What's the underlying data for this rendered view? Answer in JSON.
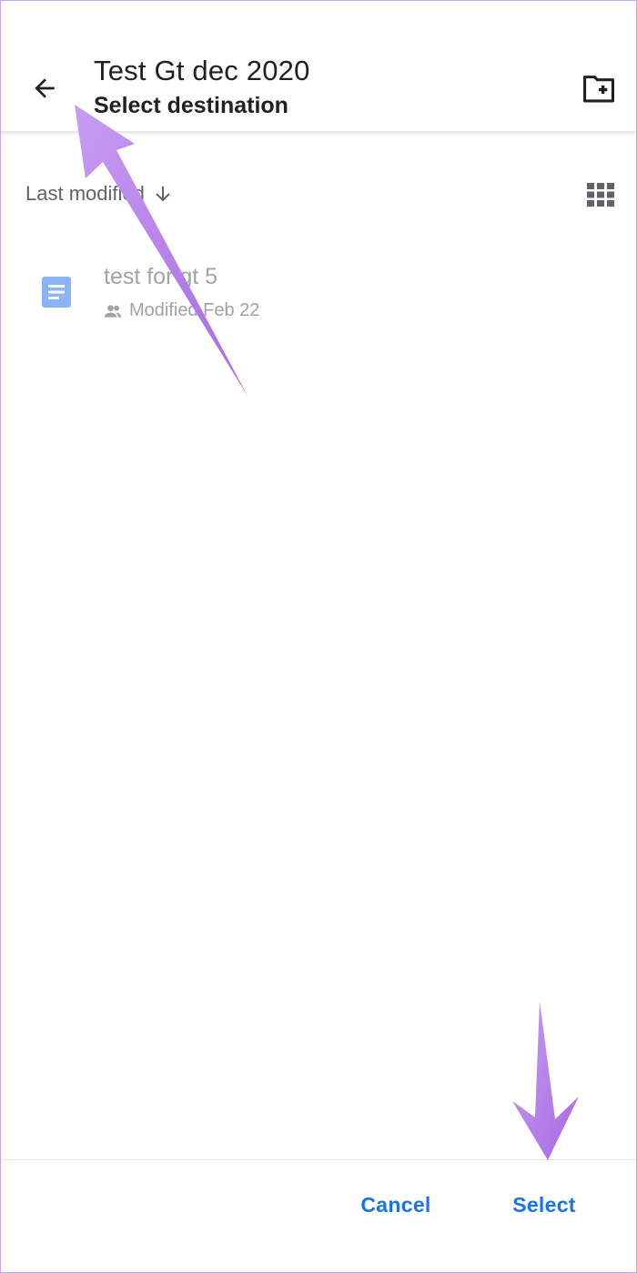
{
  "header": {
    "title": "Test Gt dec 2020",
    "subtitle": "Select destination",
    "back_icon": "arrow-back-icon",
    "new_folder_icon": "create-new-folder-icon"
  },
  "sort": {
    "label": "Last modified",
    "direction_icon": "arrow-down-icon",
    "view_icon": "grid-view-icon"
  },
  "files": [
    {
      "name": "test for gt 5",
      "icon": "google-docs-icon",
      "shared_icon": "people-icon",
      "meta": "Modified Feb 22"
    }
  ],
  "actions": {
    "cancel_label": "Cancel",
    "select_label": "Select"
  },
  "colors": {
    "accent": "#1a73e8",
    "annotation_arrow": "#b57ae8",
    "doc_icon": "#8ab4f8"
  }
}
